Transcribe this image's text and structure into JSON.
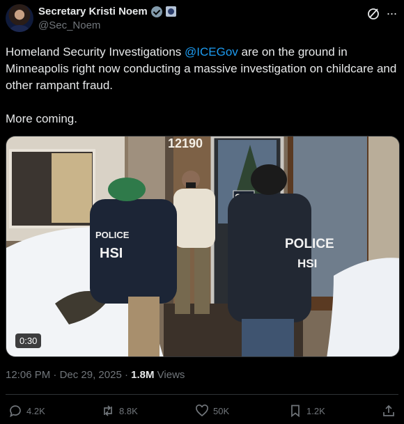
{
  "author": {
    "name": "Secretary Kristi Noem",
    "handle": "@Sec_Noem"
  },
  "tweet": {
    "text_before": "Homeland Security Investigations ",
    "mention": "@ICEGov",
    "text_after": " are on the ground in Minneapolis right now conducting a massive investigation on childcare and other rampant fraud.",
    "text_second": "More coming."
  },
  "media": {
    "duration": "0:30",
    "building_number": "12190",
    "door_sign": "OPEN",
    "jacket_left": [
      "POLICE",
      "HSI"
    ],
    "jacket_right": [
      "POLICE",
      "HSI"
    ]
  },
  "meta": {
    "time": "12:06 PM",
    "date": "Dec 29, 2025",
    "views": "1.8M",
    "views_label": "Views",
    "sep": " · "
  },
  "actions": {
    "replies": "4.2K",
    "reposts": "8.8K",
    "likes": "50K",
    "bookmarks": "1.2K"
  },
  "colors": {
    "accent": "#1d9bf0",
    "text": "#e7e9ea",
    "muted": "#71767b",
    "background": "#000000"
  }
}
